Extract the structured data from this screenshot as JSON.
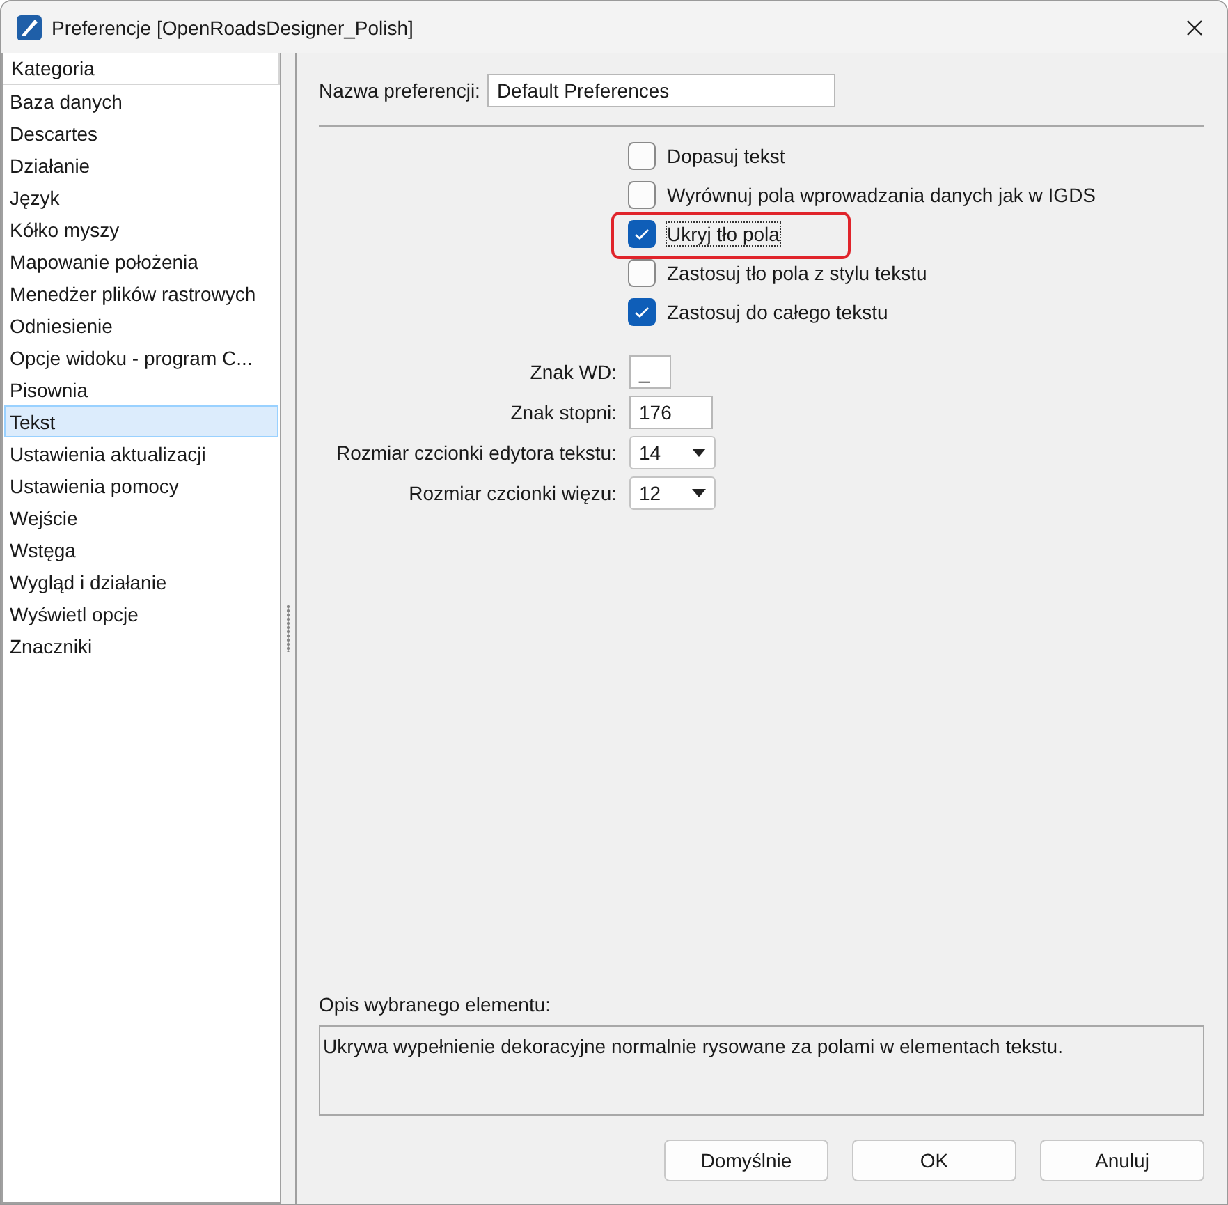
{
  "window": {
    "title": "Preferencje [OpenRoadsDesigner_Polish]"
  },
  "sidebar": {
    "header": "Kategoria",
    "items": [
      {
        "label": "Baza danych",
        "selected": false
      },
      {
        "label": "Descartes",
        "selected": false
      },
      {
        "label": "Działanie",
        "selected": false
      },
      {
        "label": "Język",
        "selected": false
      },
      {
        "label": "Kółko myszy",
        "selected": false
      },
      {
        "label": "Mapowanie położenia",
        "selected": false
      },
      {
        "label": "Menedżer plików rastrowych",
        "selected": false
      },
      {
        "label": "Odniesienie",
        "selected": false
      },
      {
        "label": "Opcje widoku - program C...",
        "selected": false
      },
      {
        "label": "Pisownia",
        "selected": false
      },
      {
        "label": "Tekst",
        "selected": true
      },
      {
        "label": "Ustawienia aktualizacji",
        "selected": false
      },
      {
        "label": "Ustawienia pomocy",
        "selected": false
      },
      {
        "label": "Wejście",
        "selected": false
      },
      {
        "label": "Wstęga",
        "selected": false
      },
      {
        "label": "Wygląd i działanie",
        "selected": false
      },
      {
        "label": "Wyświetl opcje",
        "selected": false
      },
      {
        "label": "Znaczniki",
        "selected": false
      }
    ]
  },
  "preference_name": {
    "label": "Nazwa preferencji:",
    "value": "Default Preferences"
  },
  "checkboxes": [
    {
      "label": "Dopasuj tekst",
      "checked": false,
      "highlighted": false
    },
    {
      "label": "Wyrównuj pola wprowadzania danych jak w IGDS",
      "checked": false,
      "highlighted": false
    },
    {
      "label": "Ukryj tło pola",
      "checked": true,
      "highlighted": true
    },
    {
      "label": "Zastosuj tło pola z stylu tekstu",
      "checked": false,
      "highlighted": false
    },
    {
      "label": "Zastosuj do całego tekstu",
      "checked": true,
      "highlighted": false
    }
  ],
  "fields": [
    {
      "kind": "input",
      "label": "Znak WD:",
      "value": "_"
    },
    {
      "kind": "input",
      "label": "Znak stopni:",
      "value": "176"
    },
    {
      "kind": "dropdown",
      "label": "Rozmiar czcionki edytora tekstu:",
      "value": "14"
    },
    {
      "kind": "dropdown",
      "label": "Rozmiar czcionki więzu:",
      "value": "12"
    }
  ],
  "description": {
    "label": "Opis wybranego elementu:",
    "text": "Ukrywa wypełnienie dekoracyjne normalnie rysowane za polami w elementach tekstu."
  },
  "buttons": [
    "Domyślnie",
    "OK",
    "Anuluj"
  ]
}
